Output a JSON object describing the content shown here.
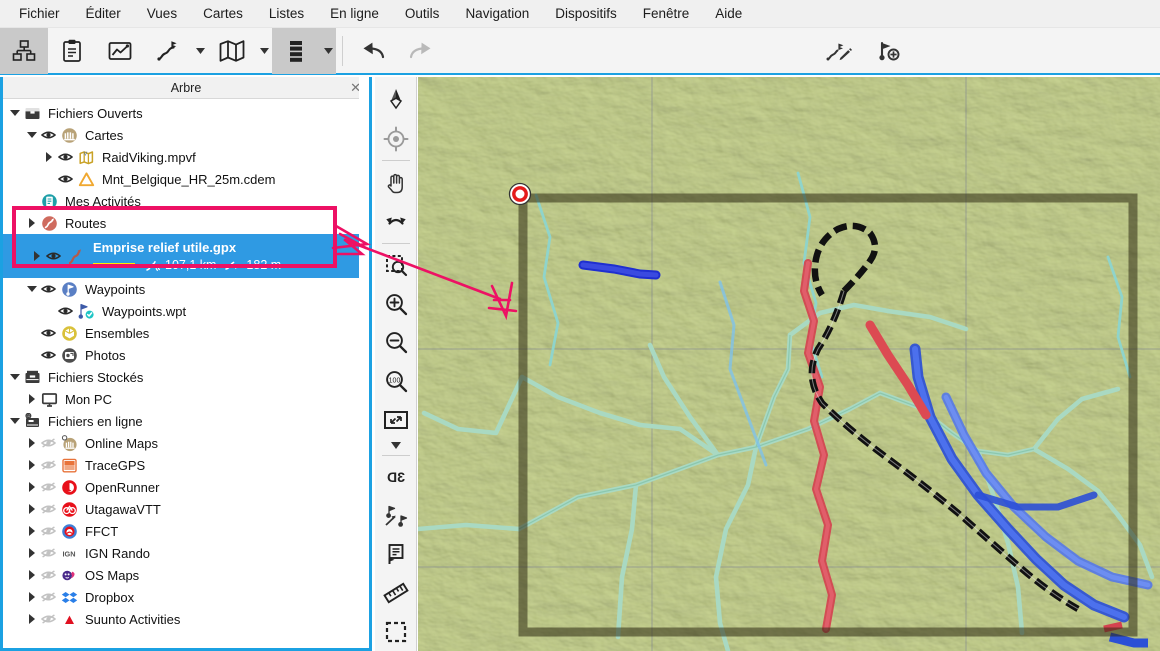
{
  "app": {
    "panel_title": "Arbre",
    "close_label": "✕"
  },
  "menubar": {
    "items": [
      {
        "label": "Fichier",
        "name": "menu-fichier"
      },
      {
        "label": "Éditer",
        "name": "menu-editer"
      },
      {
        "label": "Vues",
        "name": "menu-vues"
      },
      {
        "label": "Cartes",
        "name": "menu-cartes"
      },
      {
        "label": "Listes",
        "name": "menu-listes"
      },
      {
        "label": "En ligne",
        "name": "menu-en-ligne"
      },
      {
        "label": "Outils",
        "name": "menu-outils"
      },
      {
        "label": "Navigation",
        "name": "menu-navigation"
      },
      {
        "label": "Dispositifs",
        "name": "menu-dispositifs"
      },
      {
        "label": "Fenêtre",
        "name": "menu-fenetre"
      },
      {
        "label": "Aide",
        "name": "menu-aide"
      }
    ]
  },
  "toolbar": {
    "buttons": [
      {
        "icon": "tree-hierarchy-icon",
        "active": true
      },
      {
        "icon": "clipboard-icon",
        "active": false
      },
      {
        "icon": "profile-chart-icon",
        "active": false
      },
      {
        "icon": "route-flag-icon",
        "active": false,
        "caret": true
      },
      {
        "icon": "map-folded-icon",
        "active": false,
        "caret": true
      },
      {
        "icon": "layers-stack-icon",
        "active": true,
        "caret": true
      },
      {
        "icon": "undo-icon",
        "active": false
      },
      {
        "icon": "redo-icon",
        "active": false
      }
    ],
    "right_buttons": [
      {
        "icon": "route-edit-pencil-icon"
      },
      {
        "icon": "waypoint-add-icon"
      }
    ]
  },
  "vtoolbar": {
    "buttons": [
      {
        "icon": "compass-north-icon"
      },
      {
        "icon": "gps-target-icon"
      },
      {
        "sep": true
      },
      {
        "icon": "pan-hand-icon"
      },
      {
        "icon": "rotate-undo-icon"
      },
      {
        "sep": true
      },
      {
        "icon": "zoom-selection-icon"
      },
      {
        "icon": "zoom-in-icon"
      },
      {
        "icon": "zoom-out-icon"
      },
      {
        "icon": "zoom-100-icon"
      },
      {
        "icon": "fit-screen-icon",
        "caret": true
      },
      {
        "sep": true
      },
      {
        "icon": "view-3d-icon"
      },
      {
        "icon": "waypoints-pair-icon"
      },
      {
        "icon": "note-flag-icon"
      },
      {
        "icon": "ruler-measure-icon"
      },
      {
        "icon": "select-rectangle-icon"
      }
    ]
  },
  "tree": {
    "nodes": [
      {
        "name": "tree-item-fichiers-ouverts",
        "label": "Fichiers Ouverts",
        "indent": 0,
        "twisty": "down",
        "eye": false,
        "icon": "open-files-icon"
      },
      {
        "name": "tree-item-cartes",
        "label": "Cartes",
        "indent": 1,
        "twisty": "down",
        "eye": true,
        "icon": "maps-group-icon"
      },
      {
        "name": "tree-item-raidviking",
        "label": "RaidViking.mpvf",
        "indent": 2,
        "twisty": "right",
        "eye": true,
        "icon": "map-file-icon"
      },
      {
        "name": "tree-item-mnt-belgique",
        "label": "Mnt_Belgique_HR_25m.cdem",
        "indent": 2,
        "twisty": "none",
        "eye": true,
        "icon": "dem-triangle-icon"
      },
      {
        "name": "tree-item-mes-activites",
        "label": "Mes Activités",
        "indent": 1,
        "twisty": "none",
        "eye": false,
        "icon": "activities-icon"
      },
      {
        "name": "tree-item-routes",
        "label": "Routes",
        "indent": 1,
        "twisty": "right",
        "eye": false,
        "icon": "routes-group-icon"
      }
    ],
    "selected": {
      "name": "tree-item-emprise-relief",
      "label": "Emprise relief utile.gpx",
      "distance": "107,1 km",
      "elevation": "182 m",
      "color": "#ffee00"
    },
    "nodes2": [
      {
        "name": "tree-item-waypoints-group",
        "label": "Waypoints",
        "indent": 1,
        "twisty": "down",
        "eye": true,
        "icon": "waypoints-group-icon"
      },
      {
        "name": "tree-item-waypoints-wpt",
        "label": "Waypoints.wpt",
        "indent": 2,
        "twisty": "none",
        "eye": true,
        "icon": "waypoint-file-icon"
      },
      {
        "name": "tree-item-ensembles",
        "label": "Ensembles",
        "indent": 1,
        "twisty": "none",
        "eye": true,
        "icon": "ensembles-icon"
      },
      {
        "name": "tree-item-photos",
        "label": "Photos",
        "indent": 1,
        "twisty": "none",
        "eye": true,
        "icon": "photos-icon"
      },
      {
        "name": "tree-item-fichiers-stockes",
        "label": "Fichiers Stockés",
        "indent": 0,
        "twisty": "down",
        "eye": false,
        "icon": "stored-files-icon"
      },
      {
        "name": "tree-item-mon-pc",
        "label": "Mon PC",
        "indent": 1,
        "twisty": "right",
        "eye": false,
        "icon": "monitor-icon"
      },
      {
        "name": "tree-item-fichiers-en-ligne",
        "label": "Fichiers en ligne",
        "indent": 0,
        "twisty": "down",
        "eye": false,
        "icon": "online-files-icon"
      },
      {
        "name": "tree-item-online-maps",
        "label": "Online Maps",
        "indent": 1,
        "twisty": "right",
        "eye": "off",
        "icon": "online-maps-icon"
      },
      {
        "name": "tree-item-tracegps",
        "label": "TraceGPS",
        "indent": 1,
        "twisty": "right",
        "eye": "off",
        "icon": "tracegps-icon"
      },
      {
        "name": "tree-item-openrunner",
        "label": "OpenRunner",
        "indent": 1,
        "twisty": "right",
        "eye": "off",
        "icon": "openrunner-icon"
      },
      {
        "name": "tree-item-utagawavtt",
        "label": "UtagawaVTT",
        "indent": 1,
        "twisty": "right",
        "eye": "off",
        "icon": "utagawavtt-icon"
      },
      {
        "name": "tree-item-ffct",
        "label": "FFCT",
        "indent": 1,
        "twisty": "right",
        "eye": "off",
        "icon": "ffct-icon"
      },
      {
        "name": "tree-item-ign-rando",
        "label": "IGN Rando",
        "indent": 1,
        "twisty": "right",
        "eye": "off",
        "icon": "ign-rando-icon"
      },
      {
        "name": "tree-item-os-maps",
        "label": "OS Maps",
        "indent": 1,
        "twisty": "right",
        "eye": "off",
        "icon": "os-maps-icon"
      },
      {
        "name": "tree-item-dropbox",
        "label": "Dropbox",
        "indent": 1,
        "twisty": "right",
        "eye": "off",
        "icon": "dropbox-icon"
      },
      {
        "name": "tree-item-suunto",
        "label": "Suunto Activities",
        "indent": 1,
        "twisty": "right",
        "eye": "off",
        "icon": "suunto-icon"
      }
    ]
  },
  "map": {
    "terrain_color": "#9aab4e",
    "route_gradient": [
      "#1111ee",
      "#00d8ff",
      "#ffee00",
      "#ff8800",
      "#ff1111"
    ],
    "start_marker": "route-start-marker",
    "annotation_color": "#ed1164"
  }
}
